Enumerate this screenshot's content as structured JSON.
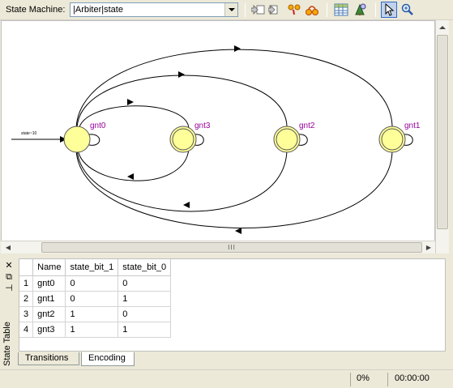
{
  "toolbar": {
    "label": "State Machine:",
    "selected_machine": "|Arbiter|state",
    "buttons": [
      "back-icon",
      "forward-icon",
      "find-icon",
      "highlight-icon",
      "table-icon",
      "tree-icon",
      "select-tool-icon",
      "zoom-icon"
    ]
  },
  "diagram": {
    "reset_label": "state~10",
    "states": [
      {
        "name": "gnt0"
      },
      {
        "name": "gnt3"
      },
      {
        "name": "gnt2"
      },
      {
        "name": "gnt1"
      }
    ],
    "scroll_grip": "III"
  },
  "state_table": {
    "title": "State Table",
    "columns": [
      "Name",
      "state_bit_1",
      "state_bit_0"
    ],
    "rows": [
      {
        "num": "1",
        "name": "gnt0",
        "bit1": "0",
        "bit0": "0"
      },
      {
        "num": "2",
        "name": "gnt1",
        "bit1": "0",
        "bit0": "1"
      },
      {
        "num": "3",
        "name": "gnt2",
        "bit1": "1",
        "bit0": "0"
      },
      {
        "num": "4",
        "name": "gnt3",
        "bit1": "1",
        "bit0": "1"
      }
    ],
    "tabs": [
      "Transitions",
      "Encoding"
    ],
    "active_tab": "Encoding"
  },
  "status": {
    "progress": "0%",
    "elapsed": "00:00:00"
  },
  "colors": {
    "state_fill": "#ffff99",
    "state_label": "#990099",
    "accent": "#316ac5"
  }
}
